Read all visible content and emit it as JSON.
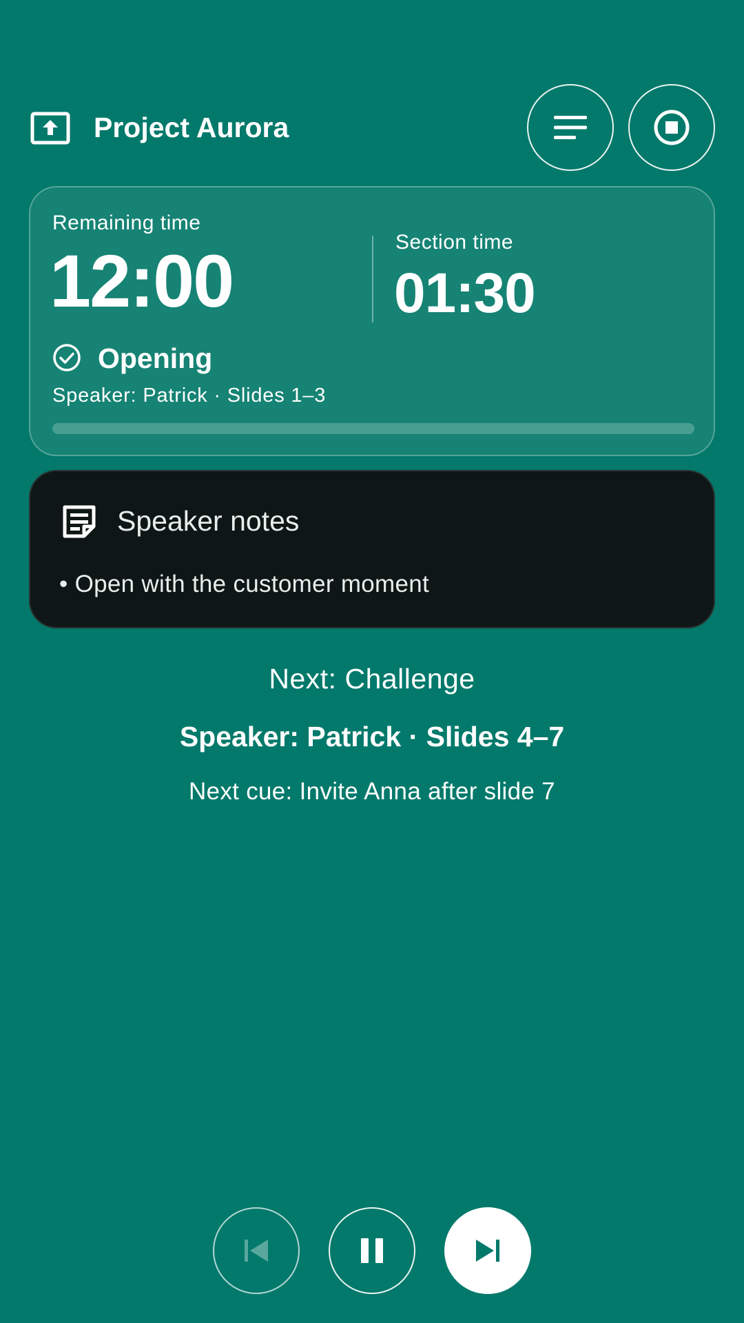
{
  "header": {
    "title": "Project Aurora",
    "icons": {
      "app": "present-to-all-icon",
      "menu": "menu-lines-icon",
      "stop": "stop-circle-icon"
    }
  },
  "timer": {
    "remaining_label": "Remaining time",
    "remaining_value": "12:00",
    "section_label": "Section time",
    "section_value": "01:30",
    "current_section": "Opening",
    "current_meta": "Speaker: Patrick · Slides 1–3",
    "progress": 0
  },
  "notes": {
    "title": "Speaker notes",
    "items": [
      "• Open with the customer moment"
    ]
  },
  "next": {
    "title": "Next: Challenge",
    "meta": "Speaker: Patrick · Slides 4–7",
    "cue": "Next cue: Invite Anna after slide 7"
  },
  "controls": {
    "icons": [
      "skip-previous-icon",
      "pause-icon",
      "skip-next-icon"
    ],
    "previous_enabled": false
  },
  "colors": {
    "background": "#02796B",
    "card": "#168374",
    "notes_card": "#0E1716",
    "on_primary": "#FFFFFF"
  }
}
